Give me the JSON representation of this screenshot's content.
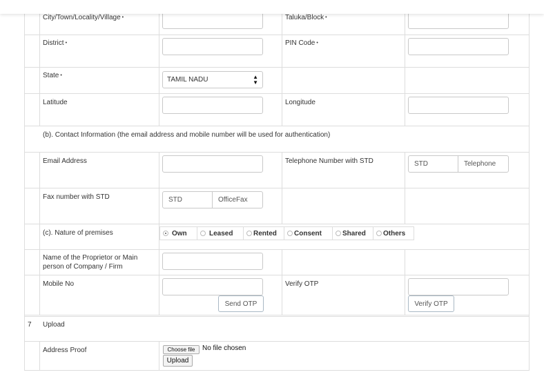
{
  "form": {
    "city_label": "City/Town/Locality/Village",
    "taluka_label": "Taluka/Block",
    "district_label": "District",
    "pin_label": "PIN Code",
    "state_label": "State",
    "state_value": "TAMIL NADU",
    "latitude_label": "Latitude",
    "longitude_label": "Longitude",
    "required_mark": "•",
    "contact_section": "(b). Contact Information (the email address and mobile number will be used for authentication)",
    "email_label": "Email Address",
    "telephone_label": "Telephone Number with STD",
    "telephone_std_placeholder": "STD",
    "telephone_number_placeholder": "Telephone",
    "fax_label": "Fax number with STD",
    "fax_std_placeholder": "STD",
    "fax_number_placeholder": "OfficeFax",
    "premises_label": "(c). Nature of premises",
    "premises_options": [
      "Own",
      "Leased",
      "Rented",
      "Consent",
      "Shared",
      "Others"
    ],
    "premises_selected": "Own",
    "proprietor_label": "Name of the Proprietor or Main person of Company / Firm",
    "mobile_label": "Mobile No",
    "send_otp_label": "Send OTP",
    "verify_otp_label": "Verify OTP",
    "verify_otp_button": "Verify OTP",
    "upload_section_number": "7",
    "upload_section_label": "Upload",
    "address_proof_label": "Address Proof",
    "choose_file_label": "Choose file",
    "no_file_text": "No file chosen",
    "upload_button": "Upload"
  }
}
